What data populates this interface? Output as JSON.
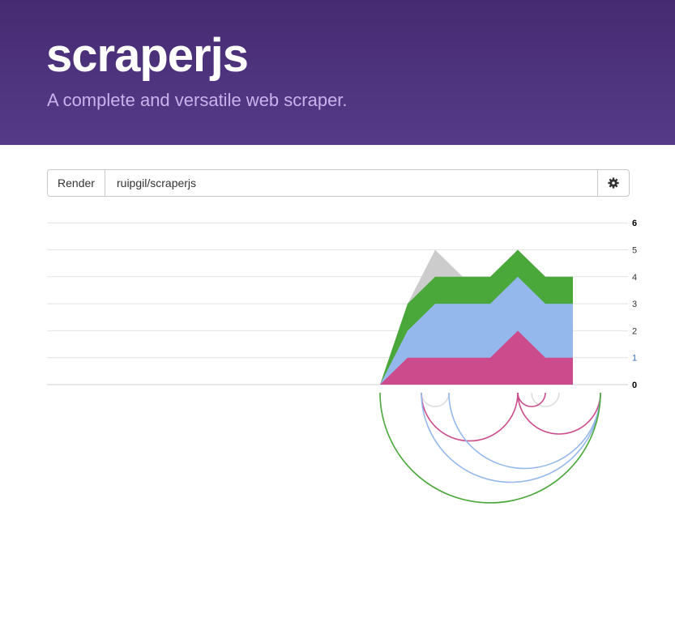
{
  "header": {
    "title": "scraperjs",
    "subtitle": "A complete and versatile web scraper."
  },
  "toolbar": {
    "render_label": "Render",
    "repo_value": "ruipgil/scraperjs",
    "settings_icon": "gear-icon"
  },
  "chart_data": {
    "type": "area",
    "stacked": true,
    "ylim": [
      0,
      6
    ],
    "y_ticks": [
      "0",
      "1",
      "2",
      "3",
      "4",
      "5",
      "6"
    ],
    "x": [
      0,
      1,
      2,
      3,
      4,
      5,
      6,
      7,
      8,
      9,
      10,
      11,
      12,
      13,
      14,
      15,
      16,
      17,
      18,
      19,
      20,
      21
    ],
    "series": [
      {
        "color": "#cc4b8c",
        "values": [
          0,
          0,
          0,
          0,
          0,
          0,
          0,
          0,
          0,
          0,
          0,
          0,
          0,
          0,
          0,
          1,
          1,
          1,
          1,
          2,
          1,
          1
        ]
      },
      {
        "color": "#94b8ec",
        "values": [
          0,
          0,
          0,
          0,
          0,
          0,
          0,
          0,
          0,
          0,
          0,
          0,
          0,
          0,
          0,
          1,
          2,
          2,
          2,
          2,
          2,
          2
        ]
      },
      {
        "color": "#4aa83a",
        "values": [
          0,
          0,
          0,
          0,
          0,
          0,
          0,
          0,
          0,
          0,
          0,
          0,
          0,
          0,
          0,
          1,
          1,
          1,
          1,
          1,
          1,
          1
        ]
      },
      {
        "color": "#cccccc",
        "values": [
          0,
          0,
          0,
          0,
          0,
          0,
          0,
          0,
          0,
          0,
          0,
          0,
          0,
          0,
          0,
          0,
          1,
          0,
          0,
          0,
          0,
          0
        ]
      }
    ],
    "arcs": [
      {
        "color": "#dddddd",
        "from": 15.5,
        "to": 16.5
      },
      {
        "color": "#dddddd",
        "from": 19.5,
        "to": 20.5
      },
      {
        "color": "#cc4b8c",
        "from": 19,
        "to": 20
      },
      {
        "color": "#cc4b8c",
        "from": 15.5,
        "to": 19
      },
      {
        "color": "#cc4b8c",
        "from": 19,
        "to": 22
      },
      {
        "color": "#94b8ec",
        "from": 15.5,
        "to": 22
      },
      {
        "color": "#94b8ec",
        "from": 16.5,
        "to": 22
      },
      {
        "color": "#4aa83a",
        "from": 14,
        "to": 22
      }
    ],
    "grid": true
  }
}
